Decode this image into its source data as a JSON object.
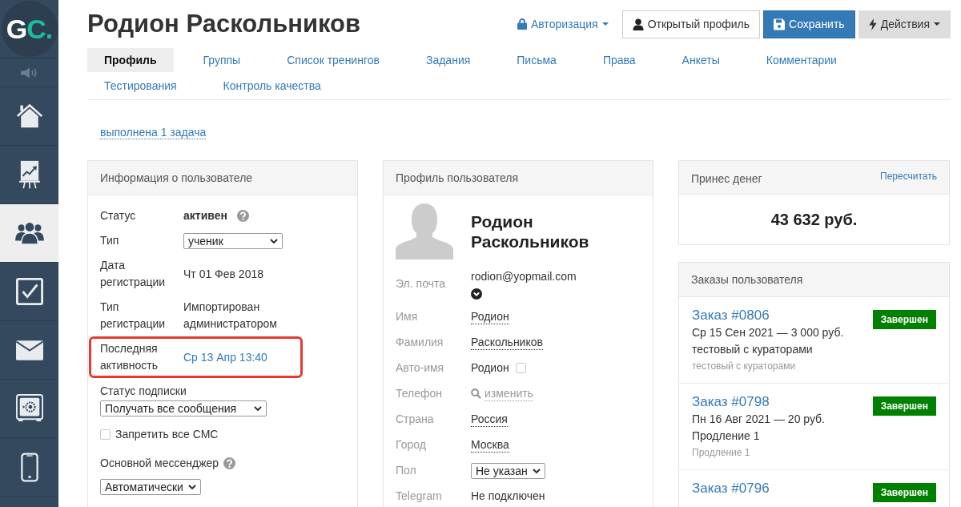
{
  "sidebar": {
    "logo": {
      "main": "G",
      "accent": "C."
    },
    "items": [
      {
        "kind": "speaker",
        "selected": false
      },
      {
        "kind": "home",
        "selected": false
      },
      {
        "kind": "chart",
        "selected": false
      },
      {
        "kind": "users",
        "selected": true
      },
      {
        "kind": "tasks",
        "selected": false
      },
      {
        "kind": "mail",
        "selected": false
      },
      {
        "kind": "safe",
        "selected": false
      },
      {
        "kind": "phone",
        "selected": false
      }
    ]
  },
  "header": {
    "title": "Родион Раскольников",
    "auth_menu": "Авторизация",
    "buttons": [
      {
        "kind": "open-profile",
        "label": "Открытый профиль"
      },
      {
        "kind": "save",
        "label": "Сохранить"
      },
      {
        "kind": "actions",
        "label": "Действия"
      }
    ]
  },
  "tabs": [
    {
      "label": "Профиль",
      "selected": true
    },
    {
      "label": "Группы",
      "selected": false
    },
    {
      "label": "Список тренингов",
      "selected": false
    },
    {
      "label": "Задания",
      "selected": false
    },
    {
      "label": "Письма",
      "selected": false
    },
    {
      "label": "Права",
      "selected": false
    },
    {
      "label": "Анкеты",
      "selected": false
    },
    {
      "label": "Комментарии",
      "selected": false
    },
    {
      "label": "Тестирования",
      "selected": false
    },
    {
      "label": "Контроль качества",
      "selected": false
    }
  ],
  "tasks_link": "выполнена 1 задача",
  "user_info": {
    "title": "Информация о пользователе",
    "rows": [
      {
        "kind": "status",
        "label": "Статус",
        "value": "активен",
        "highlighted": false
      },
      {
        "kind": "select",
        "label": "Тип",
        "value": "ученик",
        "highlighted": false
      },
      {
        "kind": "text",
        "label": "Дата регистрации",
        "value": "Чт 01 Фев 2018",
        "highlighted": false
      },
      {
        "kind": "text",
        "label": "Тип регистрации",
        "value": "Импортирован администратором",
        "highlighted": false
      },
      {
        "kind": "link",
        "label": "Последняя активность",
        "value": "Ср 13 Апр 13:40",
        "highlighted": true
      }
    ],
    "subscription": {
      "label": "Статус подписки",
      "value": "Получать все сообщения"
    },
    "block_sms": {
      "label": "Запретить все СМС",
      "checked": false
    },
    "messenger": {
      "label": "Основной мессенджер",
      "value": "Автоматически"
    }
  },
  "profile": {
    "title": "Профиль пользователя",
    "name": "Родион Раскольников",
    "fields": [
      {
        "kind": "email",
        "label": "Эл. почта",
        "value": "rodion@yopmail.com"
      },
      {
        "kind": "editable",
        "label": "Имя",
        "value": "Родион"
      },
      {
        "kind": "editable",
        "label": "Фамилия",
        "value": "Раскольников"
      },
      {
        "kind": "auto",
        "label": "Авто-имя",
        "value": "Родион",
        "checked": false
      },
      {
        "kind": "phone",
        "label": "Телефон",
        "value": "изменить"
      },
      {
        "kind": "editable",
        "label": "Страна",
        "value": "Россия"
      },
      {
        "kind": "editable",
        "label": "Город",
        "value": "Москва"
      },
      {
        "kind": "select",
        "label": "Пол",
        "value": "Не указан"
      },
      {
        "kind": "text",
        "label": "Telegram",
        "value": "Не подключен"
      }
    ]
  },
  "revenue": {
    "title": "Принес денег",
    "action": "Пересчитать",
    "amount": "43 632 руб."
  },
  "orders": {
    "title": "Заказы пользователя",
    "items": [
      {
        "title": "Заказ #0806",
        "summary": "Ср 15 Сен 2021 — 3 000 руб.",
        "offer": "тестовый с кураторами",
        "note": "тестовый с кураторами",
        "status": "Завершен"
      },
      {
        "title": "Заказ #0798",
        "summary": "Пн 16 Авг 2021 — 20 руб.",
        "offer": "Продление 1",
        "note": "Продление 1",
        "status": "Завершен"
      },
      {
        "title": "Заказ #0796",
        "status": "Завершен"
      }
    ]
  }
}
